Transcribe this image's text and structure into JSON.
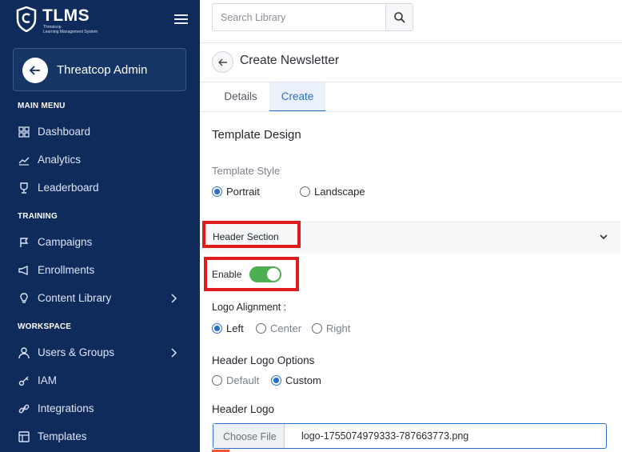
{
  "sidebar": {
    "brand": {
      "name": "TLMS",
      "sub1": "Threatcop",
      "sub2": "Learning Management System"
    },
    "admin_label": "Threatcop Admin",
    "sections": {
      "main": "MAIN MENU",
      "training": "TRAINING",
      "workspace": "WORKSPACE"
    },
    "items": {
      "dashboard": "Dashboard",
      "analytics": "Analytics",
      "leaderboard": "Leaderboard",
      "campaigns": "Campaigns",
      "enrollments": "Enrollments",
      "content_library": "Content Library",
      "users_groups": "Users & Groups",
      "iam": "IAM",
      "integrations": "Integrations",
      "templates": "Templates"
    }
  },
  "search": {
    "placeholder": "Search Library"
  },
  "page": {
    "title": "Create Newsletter"
  },
  "tabs": {
    "details": "Details",
    "create": "Create"
  },
  "form": {
    "template_design": "Template Design",
    "template_style_label": "Template Style",
    "style_options": {
      "portrait": "Portrait",
      "landscape": "Landscape"
    },
    "style_selected": "Portrait",
    "header_section": "Header Section",
    "enable_label": "Enable",
    "enable_on": true,
    "logo_alignment_label": "Logo Alignment :",
    "alignment_options": {
      "left": "Left",
      "center": "Center",
      "right": "Right"
    },
    "alignment_selected": "Left",
    "header_logo_options": "Header Logo Options",
    "logo_option_values": {
      "default": "Default",
      "custom": "Custom"
    },
    "logo_option_selected": "Custom",
    "header_logo": "Header Logo",
    "choose_file": "Choose File",
    "file_name": "logo-1755074979333-787663773.png"
  },
  "colors": {
    "sidebar": "#0f2b5b",
    "accent": "#2a6fc9",
    "toggle": "#4caf50",
    "highlight": "#e01b1b"
  }
}
